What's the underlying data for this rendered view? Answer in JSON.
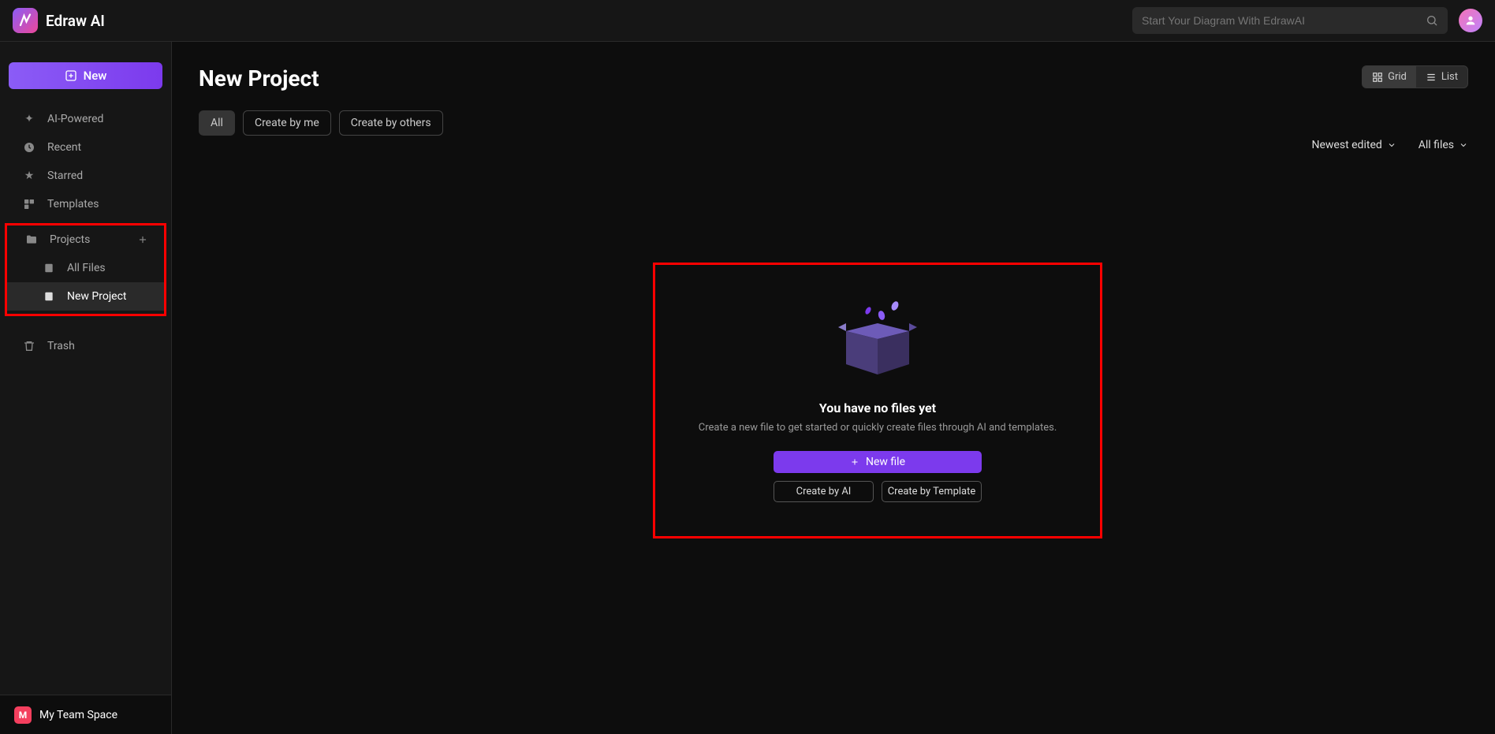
{
  "header": {
    "app_name": "Edraw AI",
    "search_placeholder": "Start Your Diagram With EdrawAI"
  },
  "sidebar": {
    "new_label": "New",
    "nav": {
      "ai_powered": "AI-Powered",
      "recent": "Recent",
      "starred": "Starred",
      "templates": "Templates",
      "projects": "Projects",
      "all_files": "All Files",
      "new_project": "New Project",
      "trash": "Trash"
    },
    "footer_label": "My Team Space",
    "footer_badge": "M"
  },
  "main": {
    "title": "New Project",
    "view": {
      "grid": "Grid",
      "list": "List"
    },
    "tabs": {
      "all": "All",
      "by_me": "Create by me",
      "by_others": "Create by others"
    },
    "sort": {
      "newest": "Newest edited",
      "files": "All files"
    },
    "empty": {
      "title": "You have no files yet",
      "subtitle": "Create a new file to get started or quickly create files through AI and templates.",
      "new_file": "New file",
      "create_ai": "Create by AI",
      "create_template": "Create by Template"
    }
  }
}
